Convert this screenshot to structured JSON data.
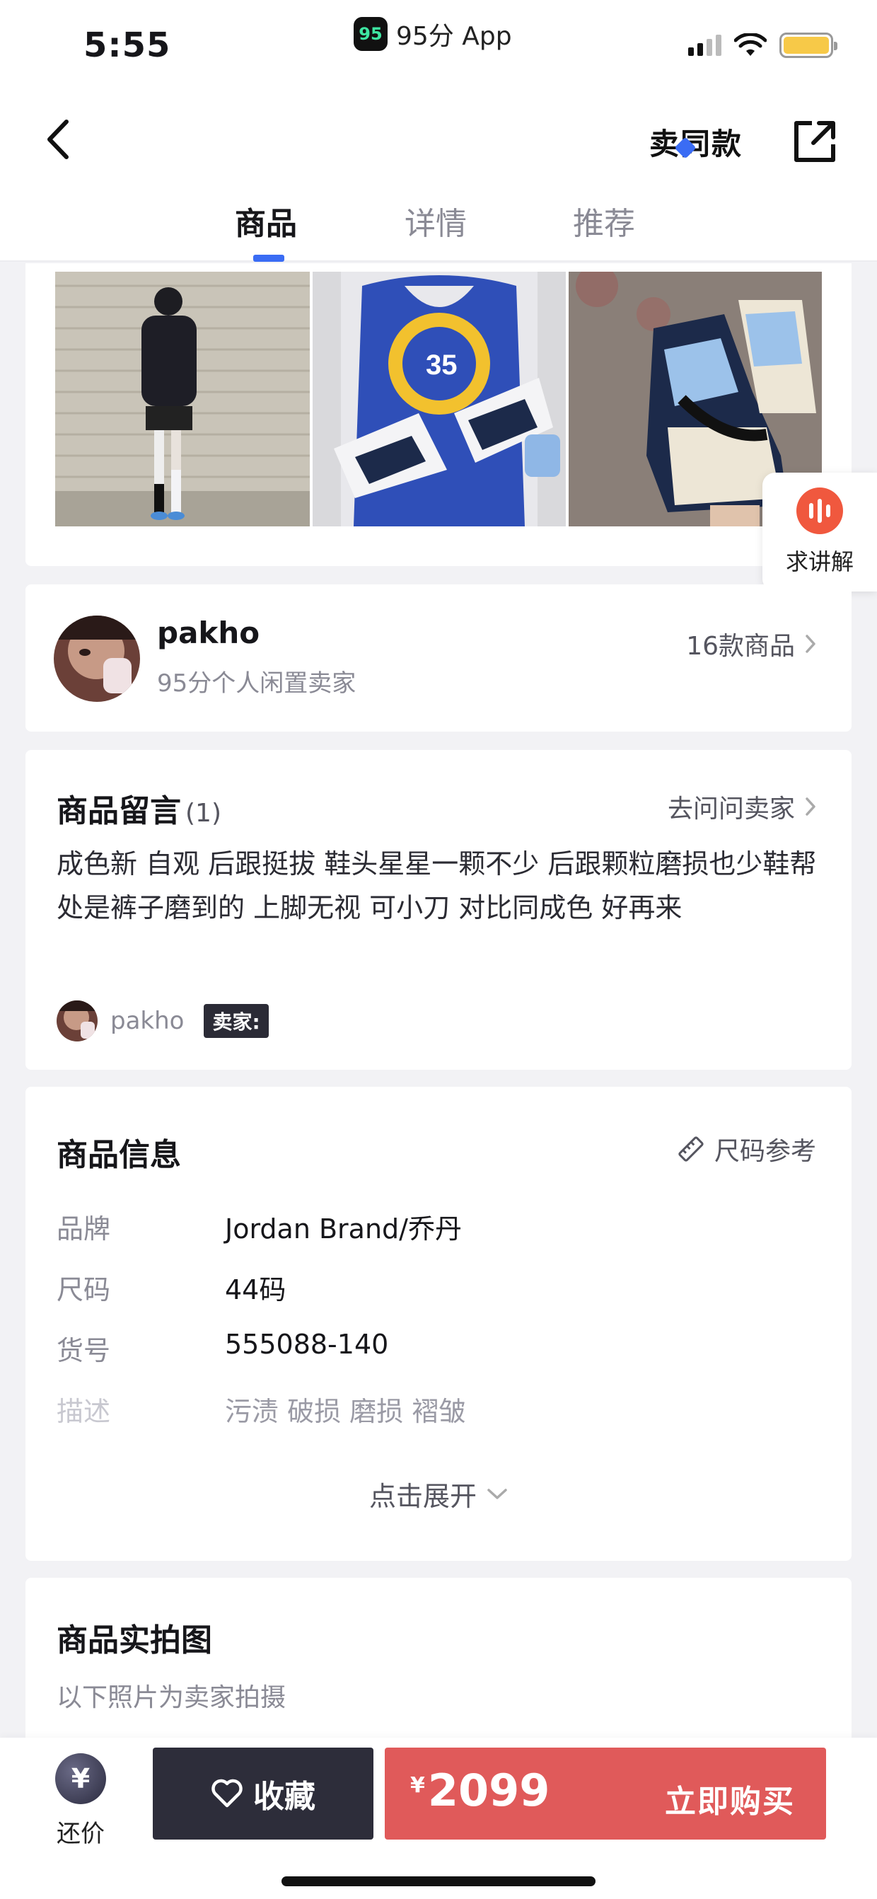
{
  "status_bar": {
    "time": "5:55",
    "app_badge": "95",
    "app_name": "95分 App"
  },
  "nav": {
    "sell_same": "卖同款",
    "tabs": [
      {
        "label": "商品",
        "active": true
      },
      {
        "label": "详情",
        "active": false
      },
      {
        "label": "推荐",
        "active": false
      }
    ]
  },
  "float_button": {
    "label": "求讲解",
    "icon": "audio-bars-icon"
  },
  "seller": {
    "name": "pakho",
    "subtitle": "95分个人闲置卖家",
    "count": "16款商品"
  },
  "messages": {
    "title": "商品留言",
    "count": "(1)",
    "ask_link": "去问问卖家",
    "text": "成色新 自观  后跟挺拔 鞋头星星一颗不少 后跟颗粒磨损也少鞋帮处是裤子磨到的 上脚无视 可小刀 对比同成色 好再来",
    "user": "pakho",
    "badge": "卖家:"
  },
  "info": {
    "title": "商品信息",
    "size_ref": "尺码参考",
    "rows": [
      {
        "key": "品牌",
        "value": "Jordan Brand/乔丹"
      },
      {
        "key": "尺码",
        "value": "44码"
      },
      {
        "key": "货号",
        "value": "555088-140"
      },
      {
        "key": "描述",
        "value": "污渍 破损 磨损 褶皱"
      }
    ],
    "expand": "点击展开"
  },
  "real_photos": {
    "title": "商品实拍图",
    "subtitle": "以下照片为卖家拍摄"
  },
  "bottom": {
    "bargain_icon": "¥",
    "bargain_label": "还价",
    "favorite_label": "收藏",
    "currency": "¥",
    "price": "2099",
    "buy_label": "立即购买"
  },
  "colors": {
    "accent": "#3a6cf4",
    "buy": "#e05a5a",
    "favorite": "#2d2d3a",
    "float_icon": "#f0583e"
  }
}
